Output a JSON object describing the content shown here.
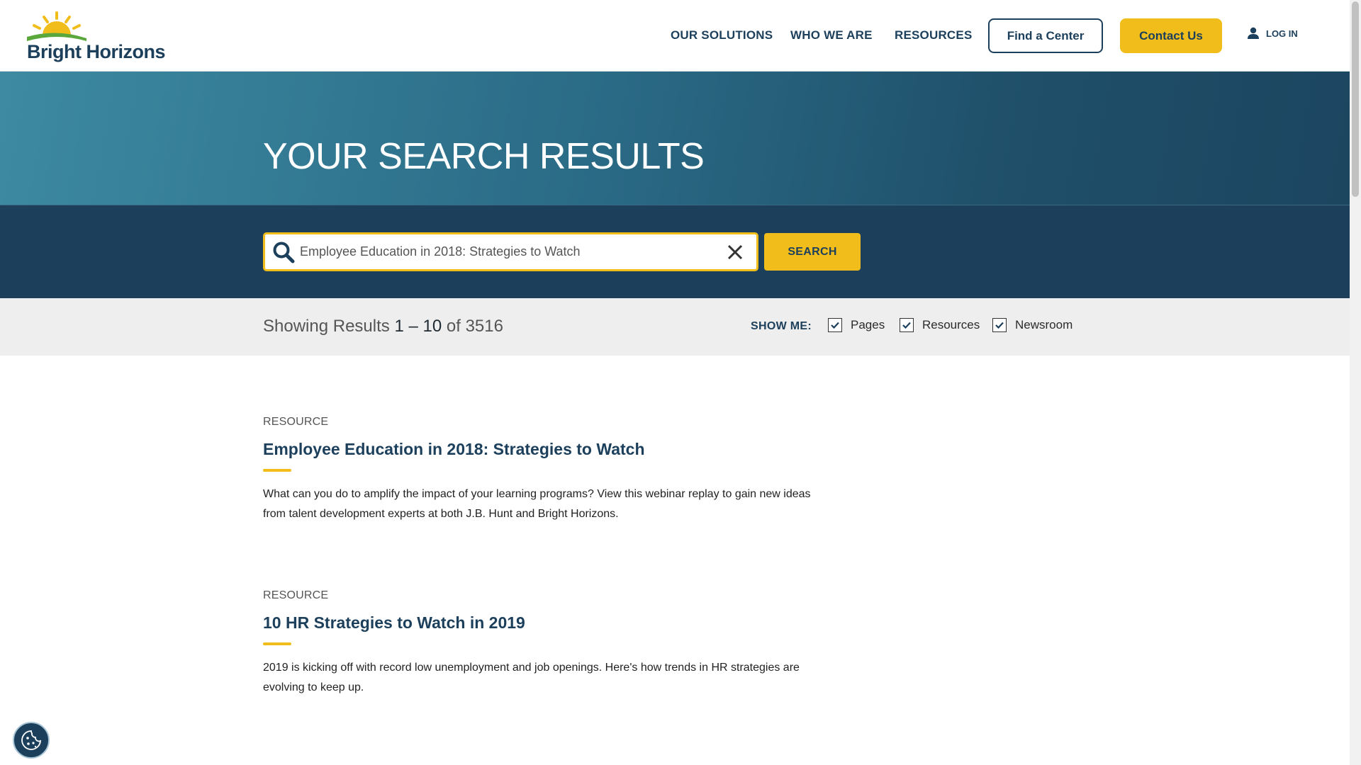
{
  "brand": {
    "name": "Bright Horizons",
    "accent": "#f0bd1b",
    "navy": "#1c3f5b"
  },
  "nav": {
    "links": [
      "OUR SOLUTIONS",
      "WHO WE ARE",
      "RESOURCES"
    ],
    "find_center": "Find a Center",
    "contact": "Contact Us",
    "login": "LOG IN"
  },
  "hero": {
    "title": "YOUR SEARCH RESULTS"
  },
  "search": {
    "value": "Employee Education in 2018: Strategies to Watch",
    "button": "SEARCH"
  },
  "filters": {
    "prefix": "Showing Results",
    "start": "1",
    "dash": "–",
    "end": "10",
    "of": "of",
    "total": "3516",
    "show_me": "SHOW ME:",
    "options": [
      {
        "label": "Pages",
        "checked": true
      },
      {
        "label": "Resources",
        "checked": true
      },
      {
        "label": "Newsroom",
        "checked": true
      }
    ]
  },
  "results": [
    {
      "type": "RESOURCE",
      "title": "Employee Education in 2018: Strategies to Watch",
      "description": "What can you do to amplify the impact of your learning programs? View this webinar replay to gain new ideas from talent development experts at both J.B. Hunt and Bright Horizons."
    },
    {
      "type": "RESOURCE",
      "title": "10 HR Strategies to Watch in 2019",
      "description": "2019 is kicking off with record low unemployment and job openings. Here's how trends in HR strategies are evolving to keep up."
    }
  ],
  "icons": {
    "logo": "sun-logo-icon",
    "user": "user-icon",
    "search": "search-icon",
    "clear": "close-icon",
    "check": "check-icon",
    "cookie": "cookie-icon"
  }
}
